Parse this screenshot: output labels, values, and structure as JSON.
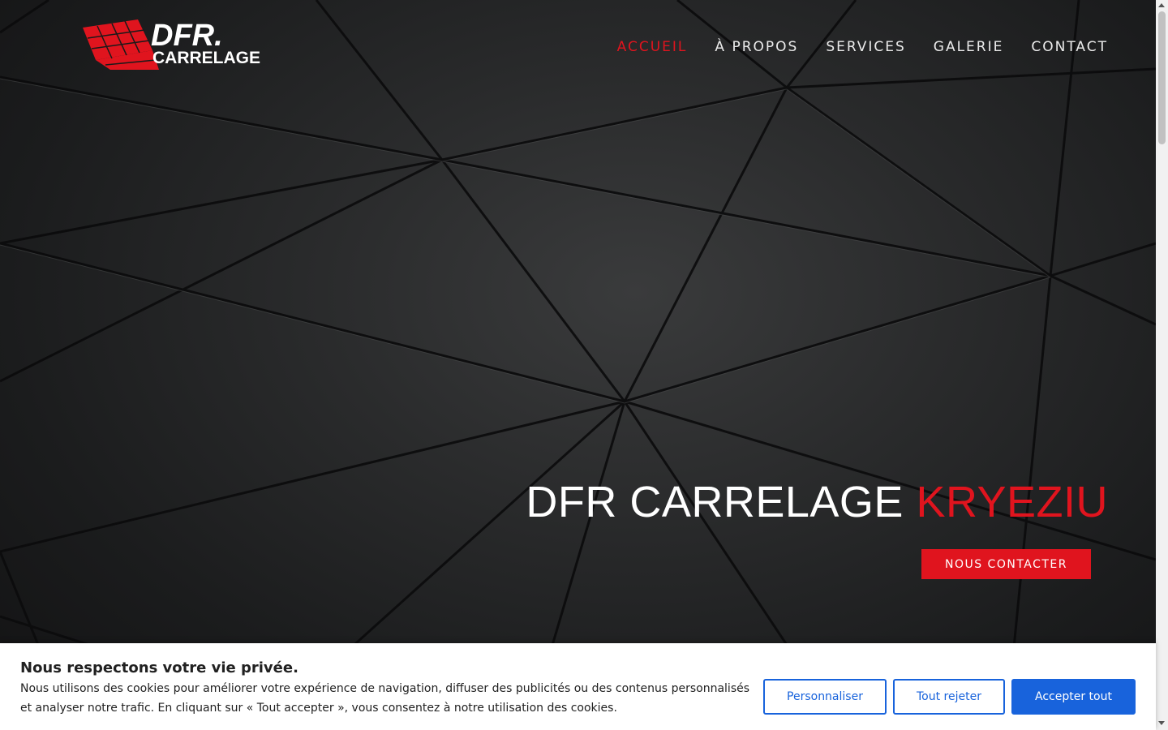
{
  "brand": {
    "logo_top": "DFR.",
    "logo_bottom": "CARRELAGE",
    "logo_red": "#e0141e"
  },
  "nav": {
    "items": [
      {
        "label": "ACCUEIL",
        "active": true
      },
      {
        "label": "À PROPOS",
        "active": false
      },
      {
        "label": "SERVICES",
        "active": false
      },
      {
        "label": "GALERIE",
        "active": false
      },
      {
        "label": "CONTACT",
        "active": false
      }
    ]
  },
  "hero": {
    "title_main": "DFR CARRELAGE ",
    "title_accent": "KRYEZIU",
    "cta_label": "NOUS CONTACTER",
    "accent_color": "#e0141e"
  },
  "cookie": {
    "title": "Nous respectons votre vie privée.",
    "text": "Nous utilisons des cookies pour améliorer votre expérience de navigation, diffuser des publicités ou des contenus personnalisés et analyser notre trafic. En cliquant sur « Tout accepter », vous consentez à notre utilisation des cookies.",
    "customize_label": "Personnaliser",
    "reject_label": "Tout rejeter",
    "accept_label": "Accepter tout",
    "button_color": "#1863dc"
  }
}
